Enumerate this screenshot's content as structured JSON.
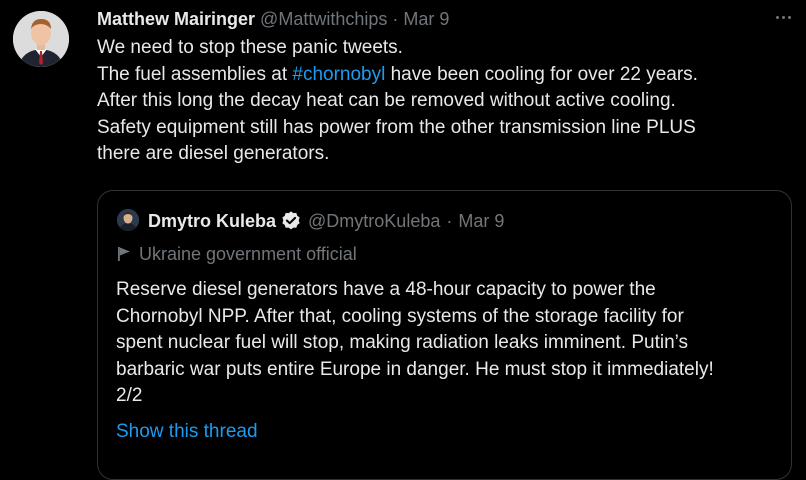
{
  "tweet": {
    "author_name": "Matthew Mairinger",
    "author_handle": "@Mattwithchips",
    "separator": "·",
    "date": "Mar 9",
    "lines": {
      "l1": "We need to stop these panic tweets.",
      "l2_pre": "The fuel assemblies at ",
      "l2_hashtag": "#chornobyl",
      "l2_post": " have been cooling for over 22 years.",
      "l3": "After this long the decay heat can be removed without active cooling.",
      "l4": "Safety equipment still has power from the other transmission line PLUS",
      "l5": "there are diesel generators."
    },
    "more_icon": "more-horizontal-icon"
  },
  "quote": {
    "author_name": "Dmytro Kuleba",
    "author_handle": "@DmytroKuleba",
    "separator": "·",
    "date": "Mar 9",
    "verified_icon": "verified-badge-icon",
    "label_icon": "flag-icon",
    "label": "Ukraine government official",
    "lines": {
      "l1": "Reserve diesel generators have a 48-hour capacity to power the",
      "l2": "Chornobyl NPP. After that, cooling systems of the storage facility for",
      "l3": "spent nuclear fuel will stop, making radiation leaks imminent. Putin’s",
      "l4": "barbaric war puts entire Europe in danger. He must stop it immediately!",
      "l5": "2/2"
    },
    "show_thread": "Show this thread"
  },
  "colors": {
    "background": "#000000",
    "text": "#e7e9ea",
    "muted": "#71767b",
    "link": "#1d9bf0",
    "border": "#2f3336",
    "verified": "#1d9bf0"
  }
}
